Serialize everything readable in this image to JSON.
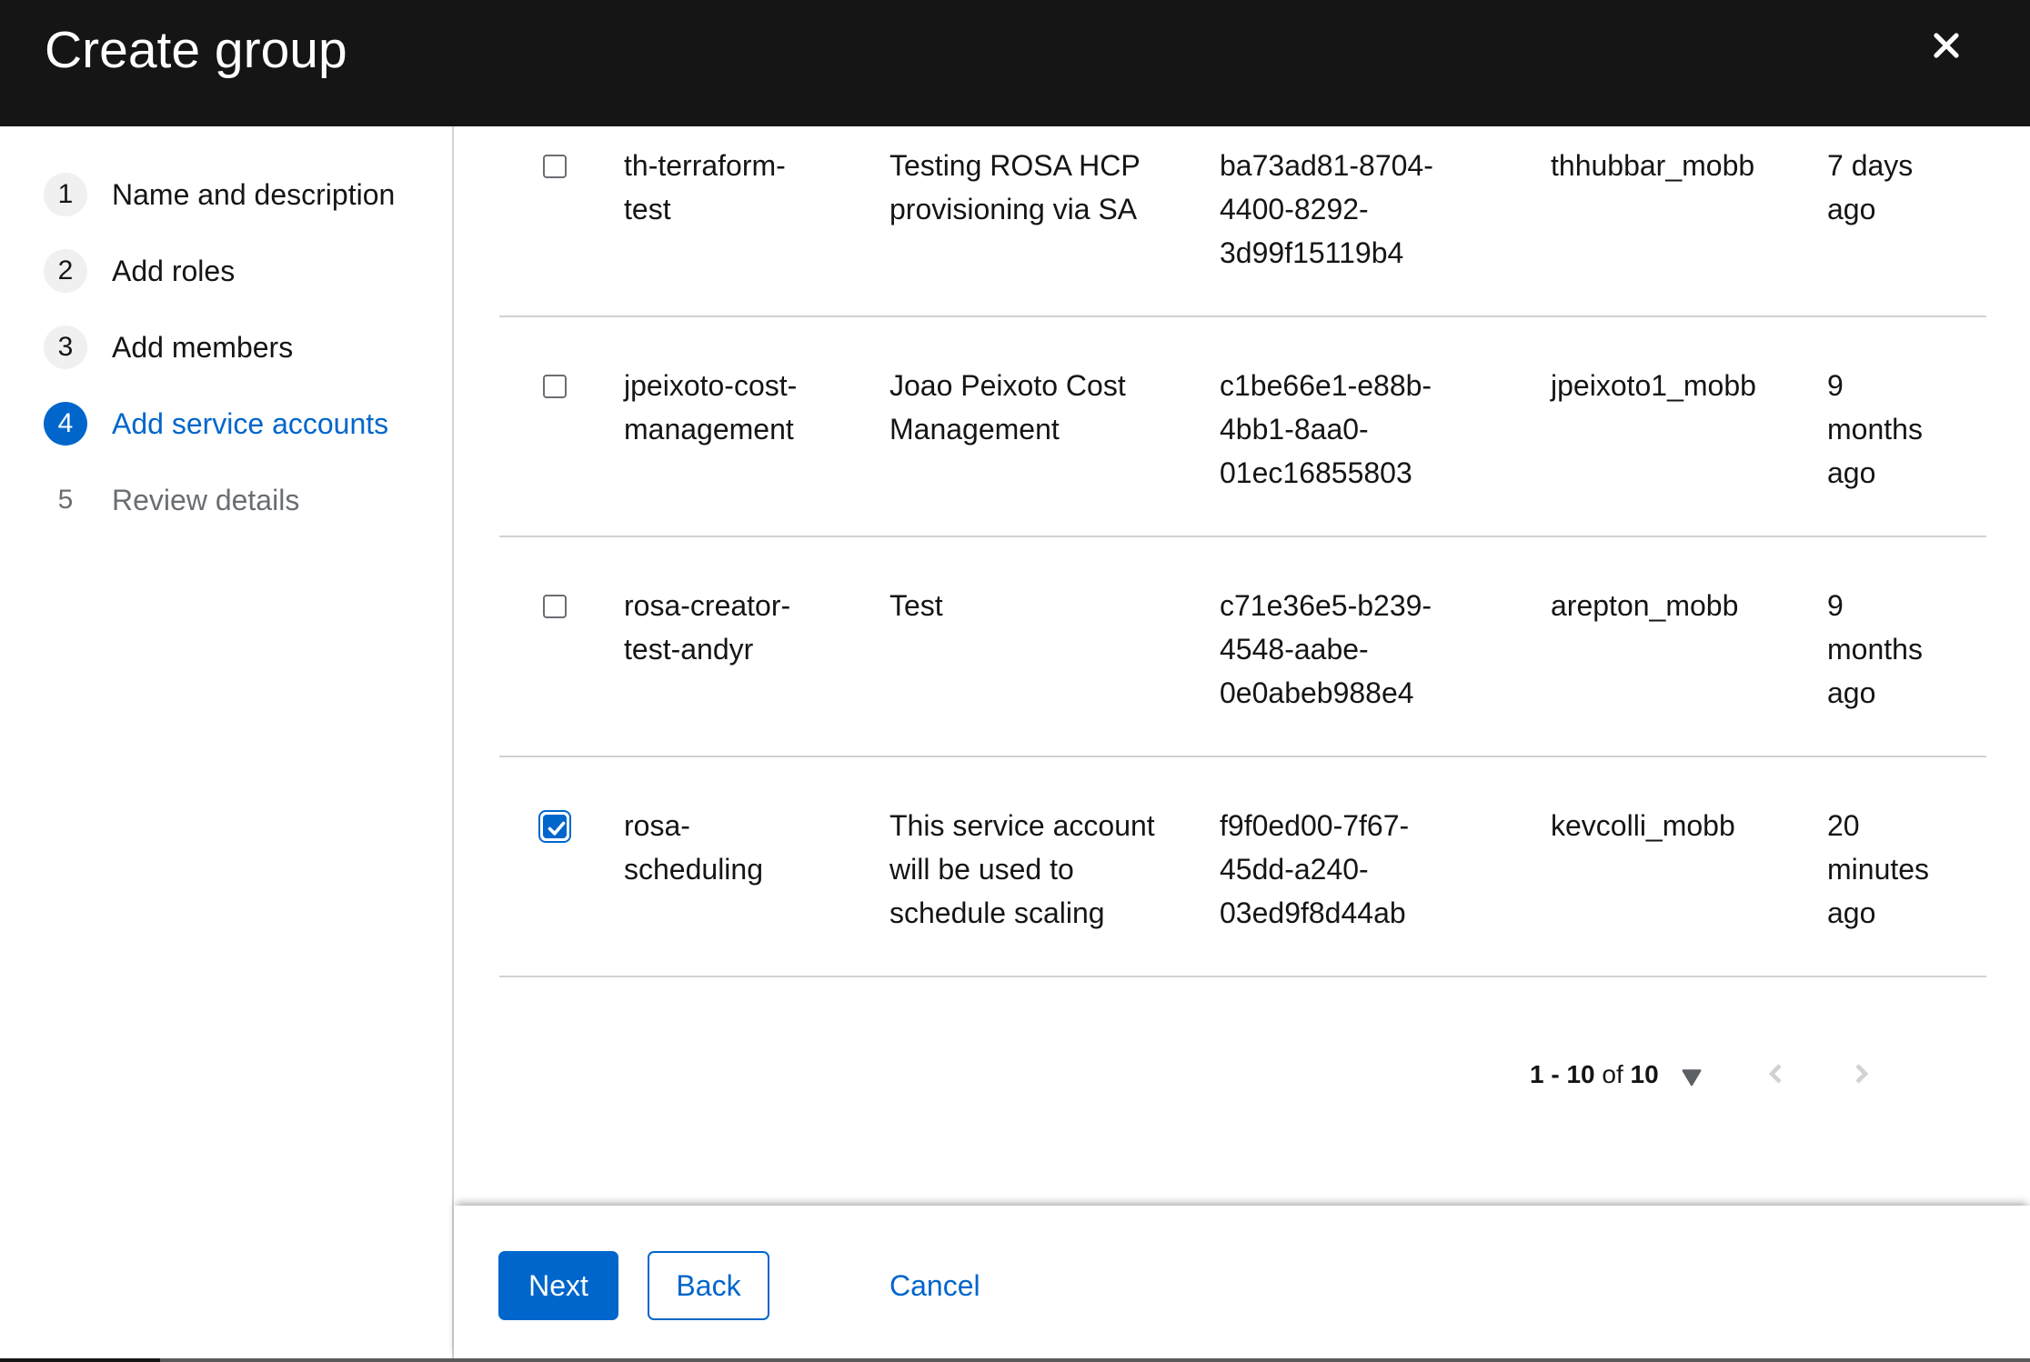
{
  "header": {
    "title": "Create group"
  },
  "steps": [
    {
      "number": "1",
      "label": "Name and description",
      "state": "default"
    },
    {
      "number": "2",
      "label": "Add roles",
      "state": "default"
    },
    {
      "number": "3",
      "label": "Add members",
      "state": "default"
    },
    {
      "number": "4",
      "label": "Add service accounts",
      "state": "current"
    },
    {
      "number": "5",
      "label": "Review details",
      "state": "disabled"
    }
  ],
  "table": {
    "rows": [
      {
        "selected": false,
        "name": "th-terraform-test",
        "description": "Testing ROSA HCP provisioning via SA",
        "client_id": "ba73ad81-8704-4400-8292-3d99f15119b4",
        "owner": "thhubbar_mobb",
        "time_created": "7 days ago"
      },
      {
        "selected": false,
        "name": "jpeixoto-cost-management",
        "description": "Joao Peixoto Cost Management",
        "client_id": "c1be66e1-e88b-4bb1-8aa0-01ec16855803",
        "owner": "jpeixoto1_mobb",
        "time_created": "9 months ago"
      },
      {
        "selected": false,
        "name": "rosa-creator-test-andyr",
        "description": "Test",
        "client_id": "c71e36e5-b239-4548-aabe-0e0abeb988e4",
        "owner": "arepton_mobb",
        "time_created": "9 months ago"
      },
      {
        "selected": true,
        "name": "rosa-scheduling",
        "description": "This service account will be used to schedule scaling",
        "client_id": "f9f0ed00-7f67-45dd-a240-03ed9f8d44ab",
        "owner": "kevcolli_mobb",
        "time_created": "20 minutes ago"
      }
    ]
  },
  "pagination": {
    "range": "1 - 10",
    "of_word": "of",
    "total": "10"
  },
  "footer": {
    "next": "Next",
    "back": "Back",
    "cancel": "Cancel"
  },
  "colors": {
    "accent": "#0066cc",
    "header_bg": "#151515",
    "separator": "#d2d2d2"
  }
}
